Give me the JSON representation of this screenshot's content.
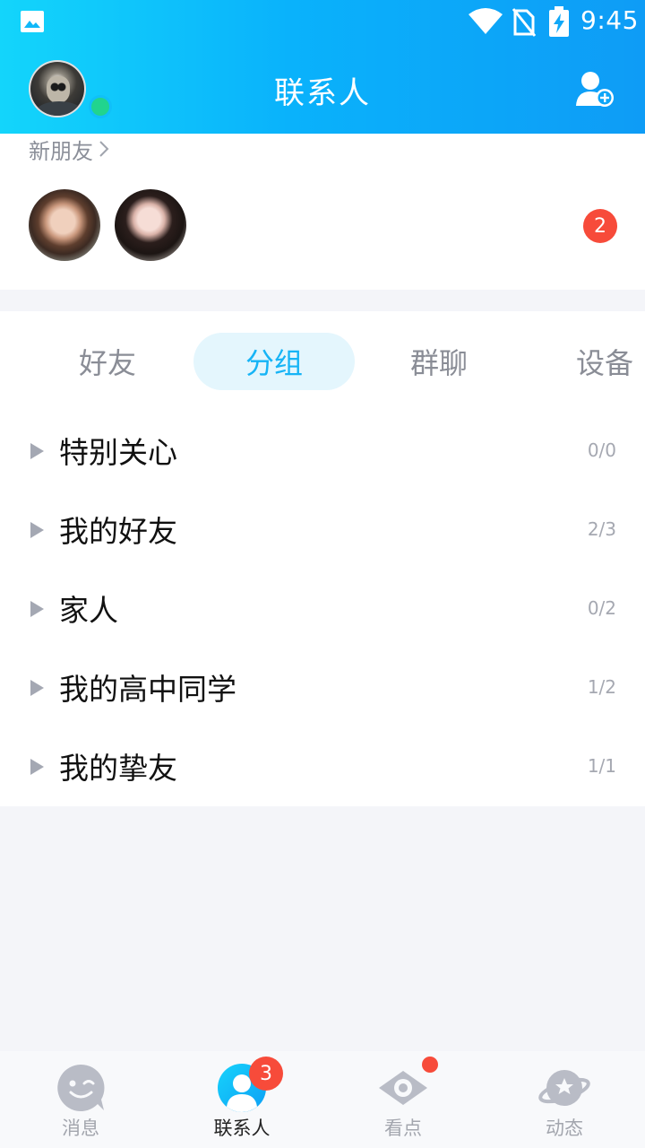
{
  "status_bar": {
    "time": "9:45"
  },
  "header": {
    "title": "联系人"
  },
  "new_friends": {
    "label": "新朋友",
    "badge": "2"
  },
  "tabs": [
    {
      "label": "好友",
      "active": false
    },
    {
      "label": "分组",
      "active": true
    },
    {
      "label": "群聊",
      "active": false
    },
    {
      "label": "设备",
      "active": false
    }
  ],
  "groups": [
    {
      "name": "特别关心",
      "count": "0/0"
    },
    {
      "name": "我的好友",
      "count": "2/3"
    },
    {
      "name": "家人",
      "count": "0/2"
    },
    {
      "name": "我的高中同学",
      "count": "1/2"
    },
    {
      "name": "我的挚友",
      "count": "1/1"
    }
  ],
  "bottom_nav": [
    {
      "label": "消息",
      "icon": "message-icon",
      "active": false
    },
    {
      "label": "联系人",
      "icon": "contacts-icon",
      "active": true,
      "badge": "3"
    },
    {
      "label": "看点",
      "icon": "eye-icon",
      "active": false,
      "dot": true
    },
    {
      "label": "动态",
      "icon": "planet-icon",
      "active": false
    }
  ],
  "colors": {
    "accent": "#16b4f6",
    "badge": "#f74b3a",
    "online": "#21d48e"
  }
}
